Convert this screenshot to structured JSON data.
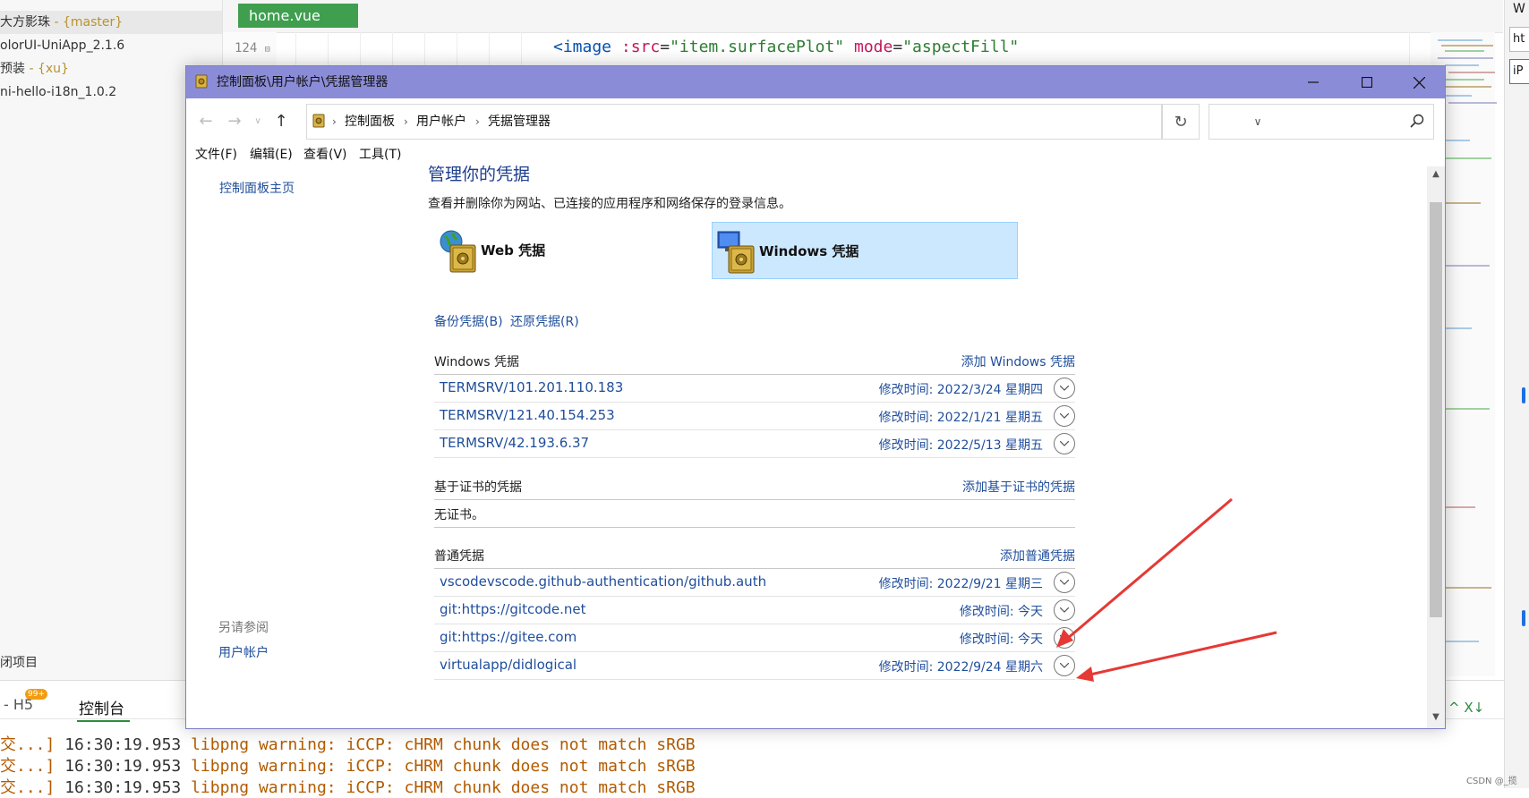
{
  "ide": {
    "projects": [
      {
        "name": "大方影珠",
        "branch": " - {master}"
      },
      {
        "name": "olorUI-UniApp_2.1.6",
        "branch": ""
      },
      {
        "name": "预装",
        "branch": " - {xu}"
      },
      {
        "name": "ni-hello-i18n_1.0.2",
        "branch": ""
      }
    ],
    "active_tab": "home.vue",
    "line_number": "124",
    "code": {
      "tag": "<image",
      "attr1": ":src",
      "eq1": "=",
      "val1": "\"item.surfacePlot\"",
      "attr2": "mode",
      "eq2": "=",
      "val2": "\"aspectFill\""
    },
    "close_project": "闭项目",
    "console_tab_h5": "- H5",
    "console_badge": "99+",
    "console_tab": "控制台",
    "console_lines": [
      {
        "prefix": "交...]",
        "time": "16:30:19.953",
        "msg": "libpng warning: iCCP: cHRM chunk does not match sRGB"
      },
      {
        "prefix": "交...]",
        "time": "16:30:19.953",
        "msg": "libpng warning: iCCP: cHRM chunk does not match sRGB"
      },
      {
        "prefix": "交...]",
        "time": "16:30:19.953",
        "msg": "libpng warning: iCCP: cHRM chunk does not match sRGB"
      }
    ],
    "right_label": "W",
    "right_field1": "ht",
    "right_field2": "iP",
    "console_controls": "^  X↓",
    "watermark": "CSDN @_揽"
  },
  "window": {
    "title": "控制面板\\用户帐户\\凭据管理器",
    "breadcrumbs": [
      "控制面板",
      "用户帐户",
      "凭据管理器"
    ],
    "search_placeholder": "",
    "menu": [
      "文件(F)",
      "编辑(E)",
      "查看(V)",
      "工具(T)"
    ],
    "left_pane": {
      "home": "控制面板主页",
      "see_also": "另请参阅",
      "user_accounts": "用户帐户"
    },
    "page_title": "管理你的凭据",
    "page_desc": "查看并删除你为网站、已连接的应用程序和网络保存的登录信息。",
    "tiles": {
      "web": "Web 凭据",
      "windows": "Windows 凭据"
    },
    "backup": "备份凭据(B)",
    "restore": "还原凭据(R)",
    "sections": {
      "windows": {
        "title": "Windows 凭据",
        "add": "添加 Windows 凭据",
        "rows": [
          {
            "name": "TERMSRV/101.201.110.183",
            "date": "修改时间:  2022/3/24 星期四"
          },
          {
            "name": "TERMSRV/121.40.154.253",
            "date": "修改时间:  2022/1/21 星期五"
          },
          {
            "name": "TERMSRV/42.193.6.37",
            "date": "修改时间:  2022/5/13 星期五"
          }
        ]
      },
      "cert": {
        "title": "基于证书的凭据",
        "add": "添加基于证书的凭据",
        "empty": "无证书。"
      },
      "generic": {
        "title": "普通凭据",
        "add": "添加普通凭据",
        "rows": [
          {
            "name": "vscodevscode.github-authentication/github.auth",
            "date": "修改时间:  2022/9/21 星期三"
          },
          {
            "name": "git:https://gitcode.net",
            "date": "修改时间:  今天"
          },
          {
            "name": "git:https://gitee.com",
            "date": "修改时间:  今天"
          },
          {
            "name": "virtualapp/didlogical",
            "date": "修改时间:  2022/9/24 星期六"
          }
        ]
      }
    }
  },
  "colors": {
    "titlebar": "#8b8cd8",
    "link": "#1f4e9c",
    "selected_tile": "#cce8ff",
    "annotation_arrow": "#e53935",
    "ide_tab": "#3f9f4f"
  }
}
